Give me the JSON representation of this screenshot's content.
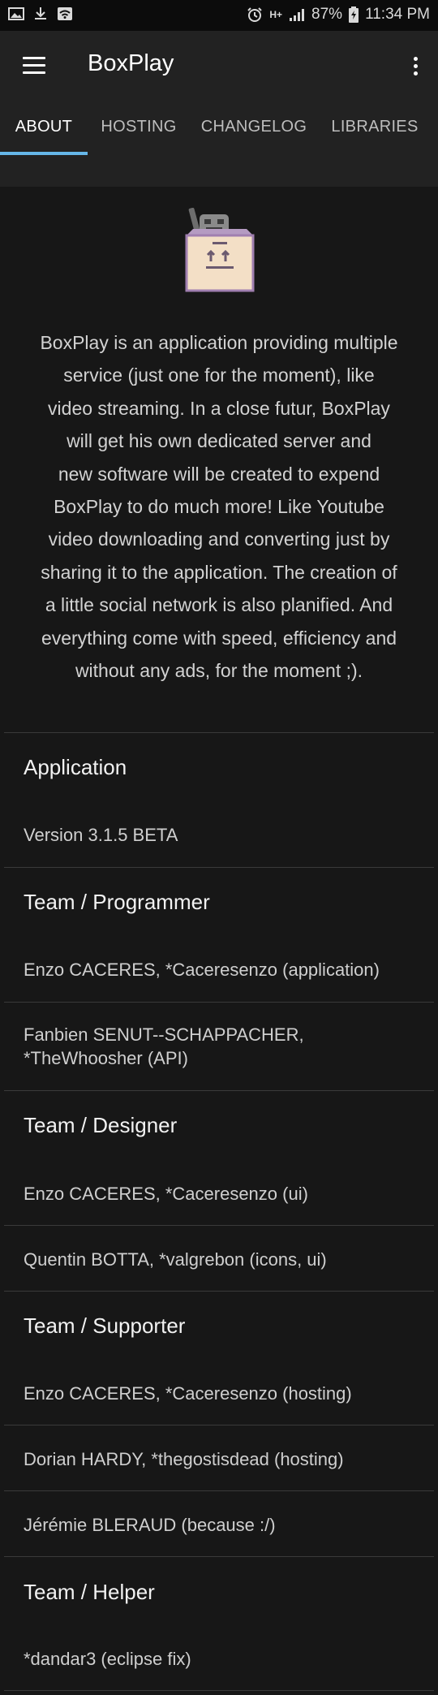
{
  "status_bar": {
    "battery": "87%",
    "time": "11:34 PM",
    "network": "H+"
  },
  "app_bar": {
    "title": "BoxPlay"
  },
  "tabs": [
    {
      "label": "ABOUT"
    },
    {
      "label": "HOSTING"
    },
    {
      "label": "CHANGELOG"
    },
    {
      "label": "LIBRARIES"
    }
  ],
  "about": {
    "description_lines": [
      "BoxPlay is an application providing multiple",
      "service (just one for the moment), like",
      "video streaming. In a close futur, BoxPlay",
      "will get his own dedicated server and",
      "new software will be created to expend",
      "BoxPlay to do much more! Like Youtube",
      "video downloading and converting just by",
      "sharing it to the application. The creation of",
      "a little social network is also planified. And",
      "everything come with speed, efficiency and",
      "without any ads, for the moment ;)."
    ]
  },
  "sections": {
    "application": {
      "title": "Application",
      "items": [
        "Version 3.1.5 BETA"
      ]
    },
    "programmer": {
      "title": "Team / Programmer",
      "items": [
        "Enzo CACERES, *Caceresenzo (application)",
        "Fanbien SENUT--SCHAPPACHER,",
        "*TheWhoosher (API)"
      ]
    },
    "designer": {
      "title": "Team / Designer",
      "items": [
        "Enzo CACERES, *Caceresenzo (ui)",
        "Quentin BOTTA, *valgrebon (icons, ui)"
      ]
    },
    "supporter": {
      "title": "Team / Supporter",
      "items": [
        "Enzo CACERES, *Caceresenzo (hosting)",
        "Dorian HARDY, *thegostisdead (hosting)",
        "Jérémie BLERAUD (because :/)"
      ]
    },
    "helper": {
      "title": "Team / Helper",
      "items": [
        "*dandar3 (eclipse fix)"
      ]
    }
  },
  "colors": {
    "background": "#171717",
    "app_bar": "#222222",
    "tab_indicator": "#66b7e9"
  }
}
